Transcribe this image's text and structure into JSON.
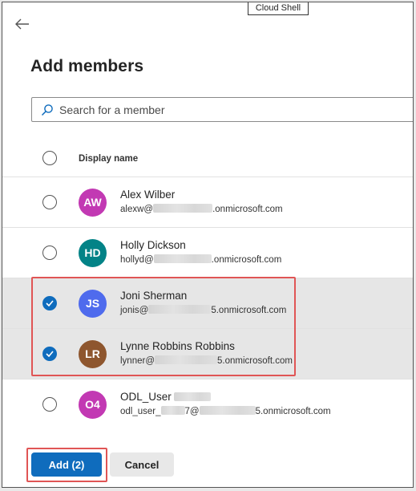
{
  "top_tab": {
    "label": "Cloud Shell"
  },
  "header": {
    "title": "Add members"
  },
  "search": {
    "placeholder": "Search for a member",
    "value": ""
  },
  "list": {
    "column_header": "Display name",
    "members": [
      {
        "initials": "AW",
        "name": "Alex Wilber",
        "email_prefix": "alexw@",
        "email_suffix": ".onmicrosoft.com",
        "avatar_color": "#c239b3",
        "selected": false
      },
      {
        "initials": "HD",
        "name": "Holly Dickson",
        "email_prefix": "hollyd@",
        "email_suffix": ".onmicrosoft.com",
        "avatar_color": "#038387",
        "selected": false
      },
      {
        "initials": "JS",
        "name": "Joni Sherman",
        "email_prefix": "jonis@",
        "email_suffix": "5.onmicrosoft.com",
        "avatar_color": "#4f6bed",
        "selected": true
      },
      {
        "initials": "LR",
        "name": "Lynne Robbins Robbins",
        "email_prefix": "lynner@",
        "email_suffix": "5.onmicrosoft.com",
        "avatar_color": "#8e562e",
        "selected": true
      },
      {
        "initials": "O4",
        "name": "ODL_User",
        "email_prefix": "odl_user_",
        "email_mid": "7@",
        "email_suffix": "5.onmicrosoft.com",
        "avatar_color": "#c239b3",
        "selected": false
      }
    ]
  },
  "footer": {
    "add_label": "Add (2)",
    "cancel_label": "Cancel"
  },
  "colors": {
    "accent": "#0f6cbd",
    "highlight": "#e05555",
    "selected_row": "#e6e6e6"
  },
  "icons": {
    "back": "arrow-left-icon",
    "search": "search-icon",
    "check": "checkmark-icon"
  }
}
